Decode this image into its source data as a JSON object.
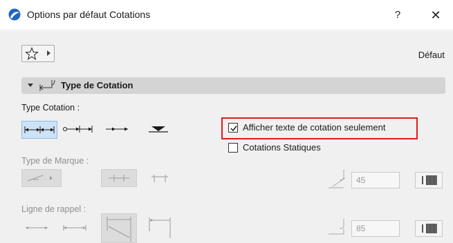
{
  "window": {
    "title": "Options par défaut Cotations",
    "help_label": "?",
    "close_label": "✕"
  },
  "toolbar": {
    "favorites_icon": "star-icon",
    "default_label": "Défaut"
  },
  "section": {
    "title": "Type de Cotation"
  },
  "type_cotation": {
    "label": "Type Cotation :",
    "options": [
      "linear-cumulative",
      "linear-chain",
      "arrows",
      "elevation"
    ],
    "selected": 0
  },
  "checkboxes": {
    "afficher_texte": {
      "label": "Afficher texte de cotation seulement",
      "checked": true
    },
    "cotations_statiques": {
      "label": "Cotations Statiques",
      "checked": false
    }
  },
  "type_marque": {
    "label": "Type de Marque :",
    "angle_value": "45"
  },
  "ligne_rappel": {
    "label": "Ligne de rappel :",
    "length_value": "85"
  },
  "colors": {
    "highlight": "#e0191d",
    "selected_bg": "#cde3f7",
    "section_bg": "#d4d4d4",
    "panel_bg": "#f0f0f0"
  }
}
